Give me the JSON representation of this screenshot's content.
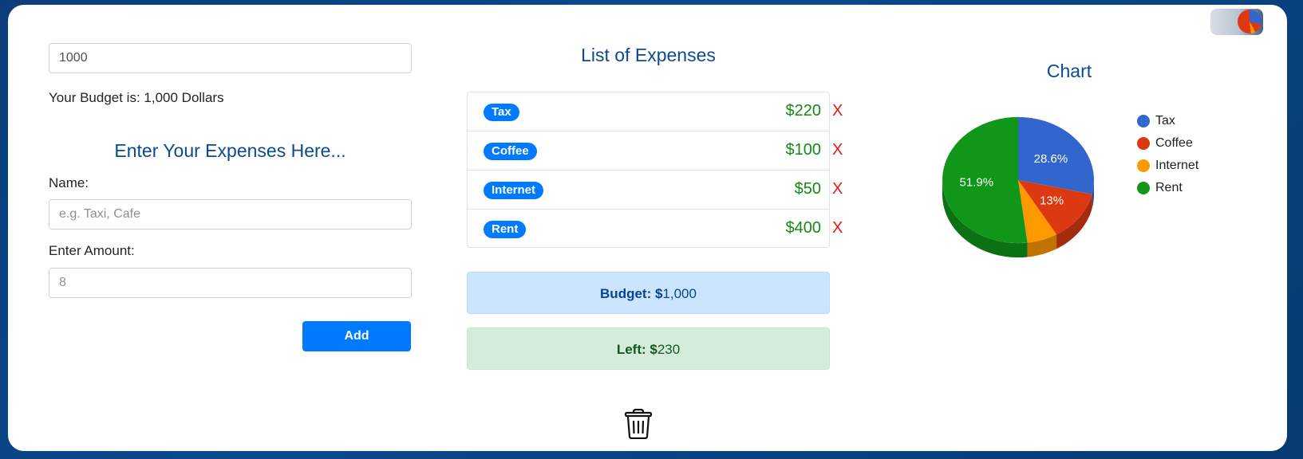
{
  "budget_input": {
    "value": "1000"
  },
  "budget_text": "Your Budget is: 1,000 Dollars",
  "entry": {
    "title": "Enter Your Expenses Here...",
    "name_label": "Name:",
    "name_placeholder": "e.g. Taxi, Cafe",
    "amount_label": "Enter Amount:",
    "amount_placeholder": "8",
    "add_label": "Add"
  },
  "list": {
    "title": "List of Expenses",
    "delete_label": "X",
    "items": [
      {
        "name": "Tax",
        "amount": "$220"
      },
      {
        "name": "Coffee",
        "amount": "$100"
      },
      {
        "name": "Internet",
        "amount": "$50"
      },
      {
        "name": "Rent",
        "amount": "$400"
      }
    ]
  },
  "summary": {
    "budget_label": "Budget: $",
    "budget_value": "1,000",
    "left_label": "Left: $",
    "left_value": "230"
  },
  "icons": {
    "trash": "trash-icon",
    "theme_toggle": "chart-thumbnail-icon"
  },
  "chart_data": {
    "type": "pie",
    "title": "Chart",
    "labels": [
      "Tax",
      "Coffee",
      "Internet",
      "Rent"
    ],
    "values": [
      220,
      100,
      50,
      400
    ],
    "slice_labels": [
      "28.6%",
      "13%",
      "",
      "51.9%"
    ],
    "colors": [
      "#3366cc",
      "#dc3912",
      "#ff9900",
      "#109618"
    ],
    "legend_position": "right"
  }
}
